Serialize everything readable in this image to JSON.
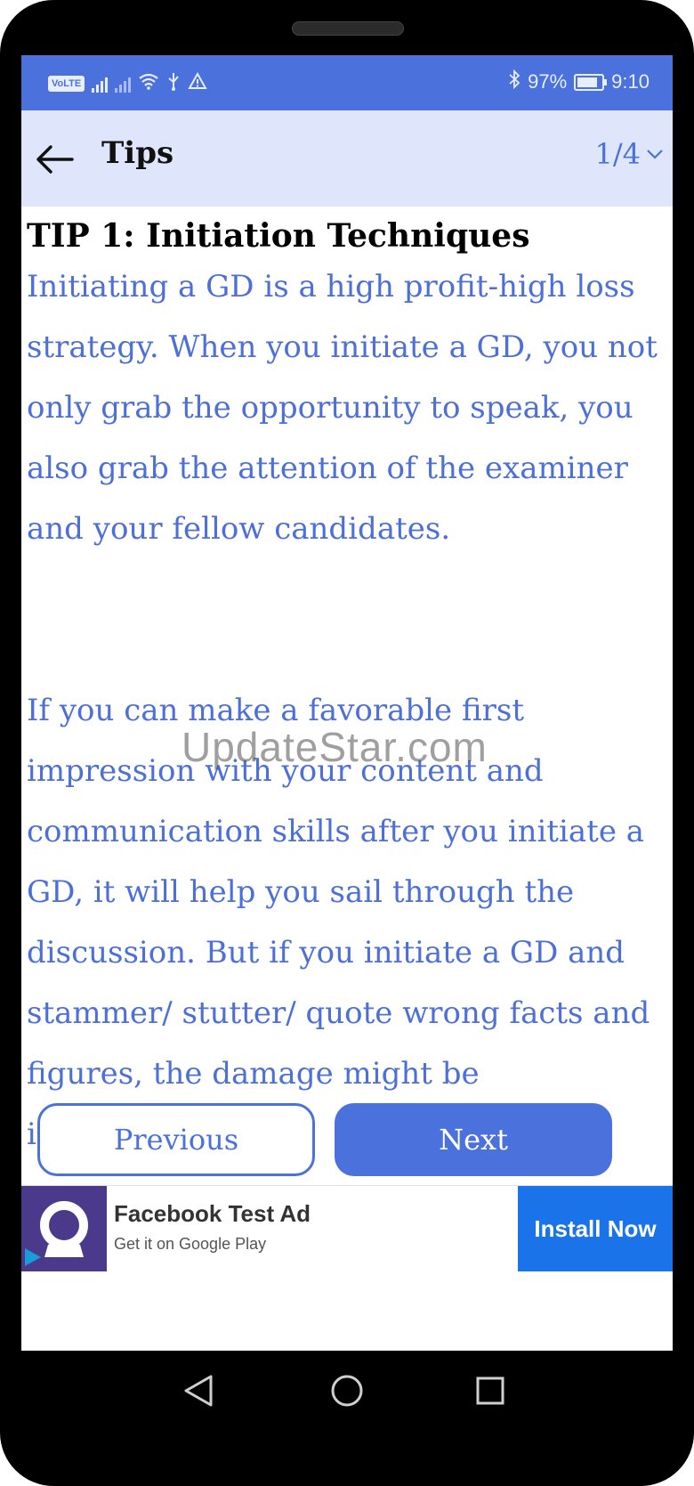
{
  "status_bar": {
    "volte": "VoLTE",
    "battery_percent": "97%",
    "time": "9:10"
  },
  "app_bar": {
    "title": "Tips",
    "page_indicator": "1/4"
  },
  "tip": {
    "heading": "TIP 1: Initiation Techniques",
    "paragraph_1": "Initiating a GD is a high profit-high loss strategy. When you initiate a GD, you not only grab the opportunity to speak, you also grab the attention of the examiner and your fellow candidates.",
    "paragraph_2": "If you can make a favorable first impression with your content and communication skills after you initiate a GD, it will help you sail through the discussion. But if you initiate a GD and stammer/ stutter/ quote wrong facts and figures, the damage might be irreparable."
  },
  "watermark": "UpdateStar.com",
  "buttons": {
    "previous": "Previous",
    "next": "Next"
  },
  "ad": {
    "title": "Facebook Test Ad",
    "subtitle": "Get it on Google Play",
    "cta": "Install Now"
  },
  "colors": {
    "accent": "#4b71dc",
    "app_bar_bg": "#dfe6fb",
    "text_blue": "#4d6fd8",
    "ad_button": "#1a73e8"
  },
  "icons": {
    "back": "arrow-left-icon",
    "dropdown": "chevron-down-icon",
    "nav_back": "triangle-back-icon",
    "nav_home": "circle-home-icon",
    "nav_recents": "square-recents-icon"
  }
}
